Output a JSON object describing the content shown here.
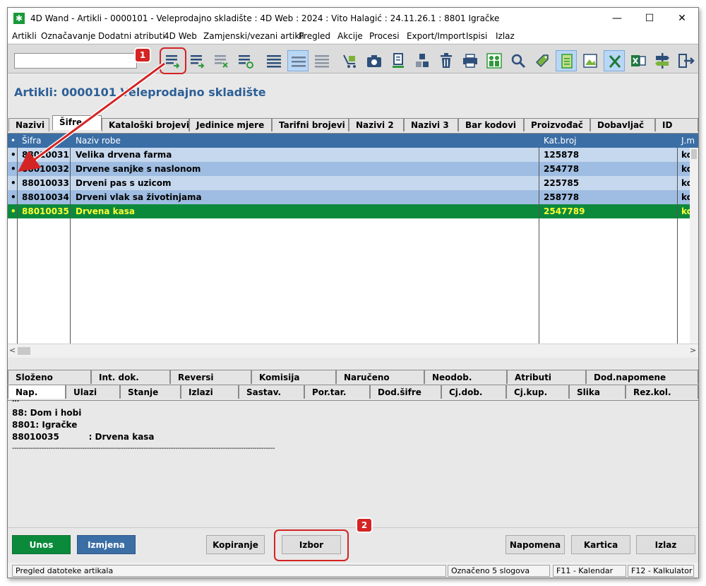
{
  "window": {
    "title": "4D Wand - Artikli - 0000101 - Veleprodajno skladište : 4D Web : 2024 : Vito Halagić : 24.11.26.1 : 8801 Igračke",
    "app_icon": "✱",
    "minimize": "—",
    "maximize": "☐",
    "close": "✕"
  },
  "menu": [
    "Artikli",
    "Označavanje",
    "Dodatni atributi",
    "4D Web",
    "Zamjenski/vezani artikli",
    "Pregled",
    "Akcije",
    "Procesi",
    "Export/Import",
    "Ispisi",
    "Izlaz"
  ],
  "toolbar": {
    "search_value": "",
    "icons": [
      "list-add-icon",
      "list-insert-icon",
      "list-remove-icon",
      "list-refresh-icon",
      "lines-icon",
      "lines-selected-icon",
      "lines-gray-icon",
      "cart-icon",
      "camera-icon",
      "document-icon",
      "blocks-icon",
      "trash-icon",
      "printer-icon",
      "people-icon",
      "search-icon",
      "tag-icon",
      "notes-icon",
      "image-icon",
      "excel-icon",
      "excel-export-icon",
      "signpost-icon",
      "exit-icon"
    ]
  },
  "page_title": "Artikli: 0000101 Veleprodajno skladište",
  "main_tabs": [
    "Nazivi",
    "Šifre",
    "Kataloški brojevi",
    "Jedinice mjere",
    "Tarifni brojevi",
    "Nazivi 2",
    "Nazivi 3",
    "Bar kodovi",
    "Proizvođač",
    "Dobavljač",
    "ID"
  ],
  "grid": {
    "columns": [
      "•",
      "Šifra",
      "Naziv robe",
      "Kat.broj",
      "J.m"
    ],
    "rows": [
      {
        "mark": "•",
        "sifra": "88010031",
        "naziv": "Velika drvena farma",
        "kat": "125878",
        "jm": "kom"
      },
      {
        "mark": "•",
        "sifra": "88010032",
        "naziv": "Drvene sanjke s naslonom",
        "kat": "254778",
        "jm": "kom"
      },
      {
        "mark": "•",
        "sifra": "88010033",
        "naziv": "Drveni pas s uzicom",
        "kat": "225785",
        "jm": "kom"
      },
      {
        "mark": "•",
        "sifra": "88010034",
        "naziv": "Drveni vlak sa životinjama",
        "kat": "258778",
        "jm": "kom"
      },
      {
        "mark": "•",
        "sifra": "88010035",
        "naziv": "Drvena kasa",
        "kat": "2547789",
        "jm": "kom"
      }
    ],
    "scroll_left": "<",
    "scroll_right": ">"
  },
  "sub_tabs_top": [
    "Složeno",
    "Int. dok.",
    "Reversi",
    "Komisija",
    "Naručeno",
    "Neodob.",
    "Atributi",
    "Dod.napomene"
  ],
  "sub_tabs_bottom": [
    "Nap.",
    "Ulazi",
    "Stanje",
    "Izlazi",
    "Sastav.",
    "Por.tar.",
    "Dod.šifre",
    "Cj.dob.",
    "Cj.kup.",
    "Slika",
    "Rez.kol."
  ],
  "notes": {
    "line0": "...",
    "line1": "88: Dom i hobi",
    "line2": "8801: Igračke",
    "line3": "88010035          : Drvena kasa",
    "line4": "--------------------------------------------------------------------------------------------------------------------"
  },
  "buttons": {
    "unos": "Unos",
    "izmjena": "Izmjena",
    "kopiranje": "Kopiranje",
    "izbor": "Izbor",
    "napomena": "Napomena",
    "kartica": "Kartica",
    "izlaz": "Izlaz"
  },
  "callouts": {
    "one": "1",
    "two": "2"
  },
  "status": {
    "left": "Pregled datoteke artikala",
    "count": "Označeno 5 slogova",
    "f11": "F11 - Kalendar",
    "f12": "F12 - Kalkulator"
  },
  "colors": {
    "header_blue": "#3b6ea5",
    "selected_green": "#0c8a3c",
    "selected_text": "#ffff33",
    "callout_red": "#d42424",
    "title_blue": "#2d5f96"
  }
}
